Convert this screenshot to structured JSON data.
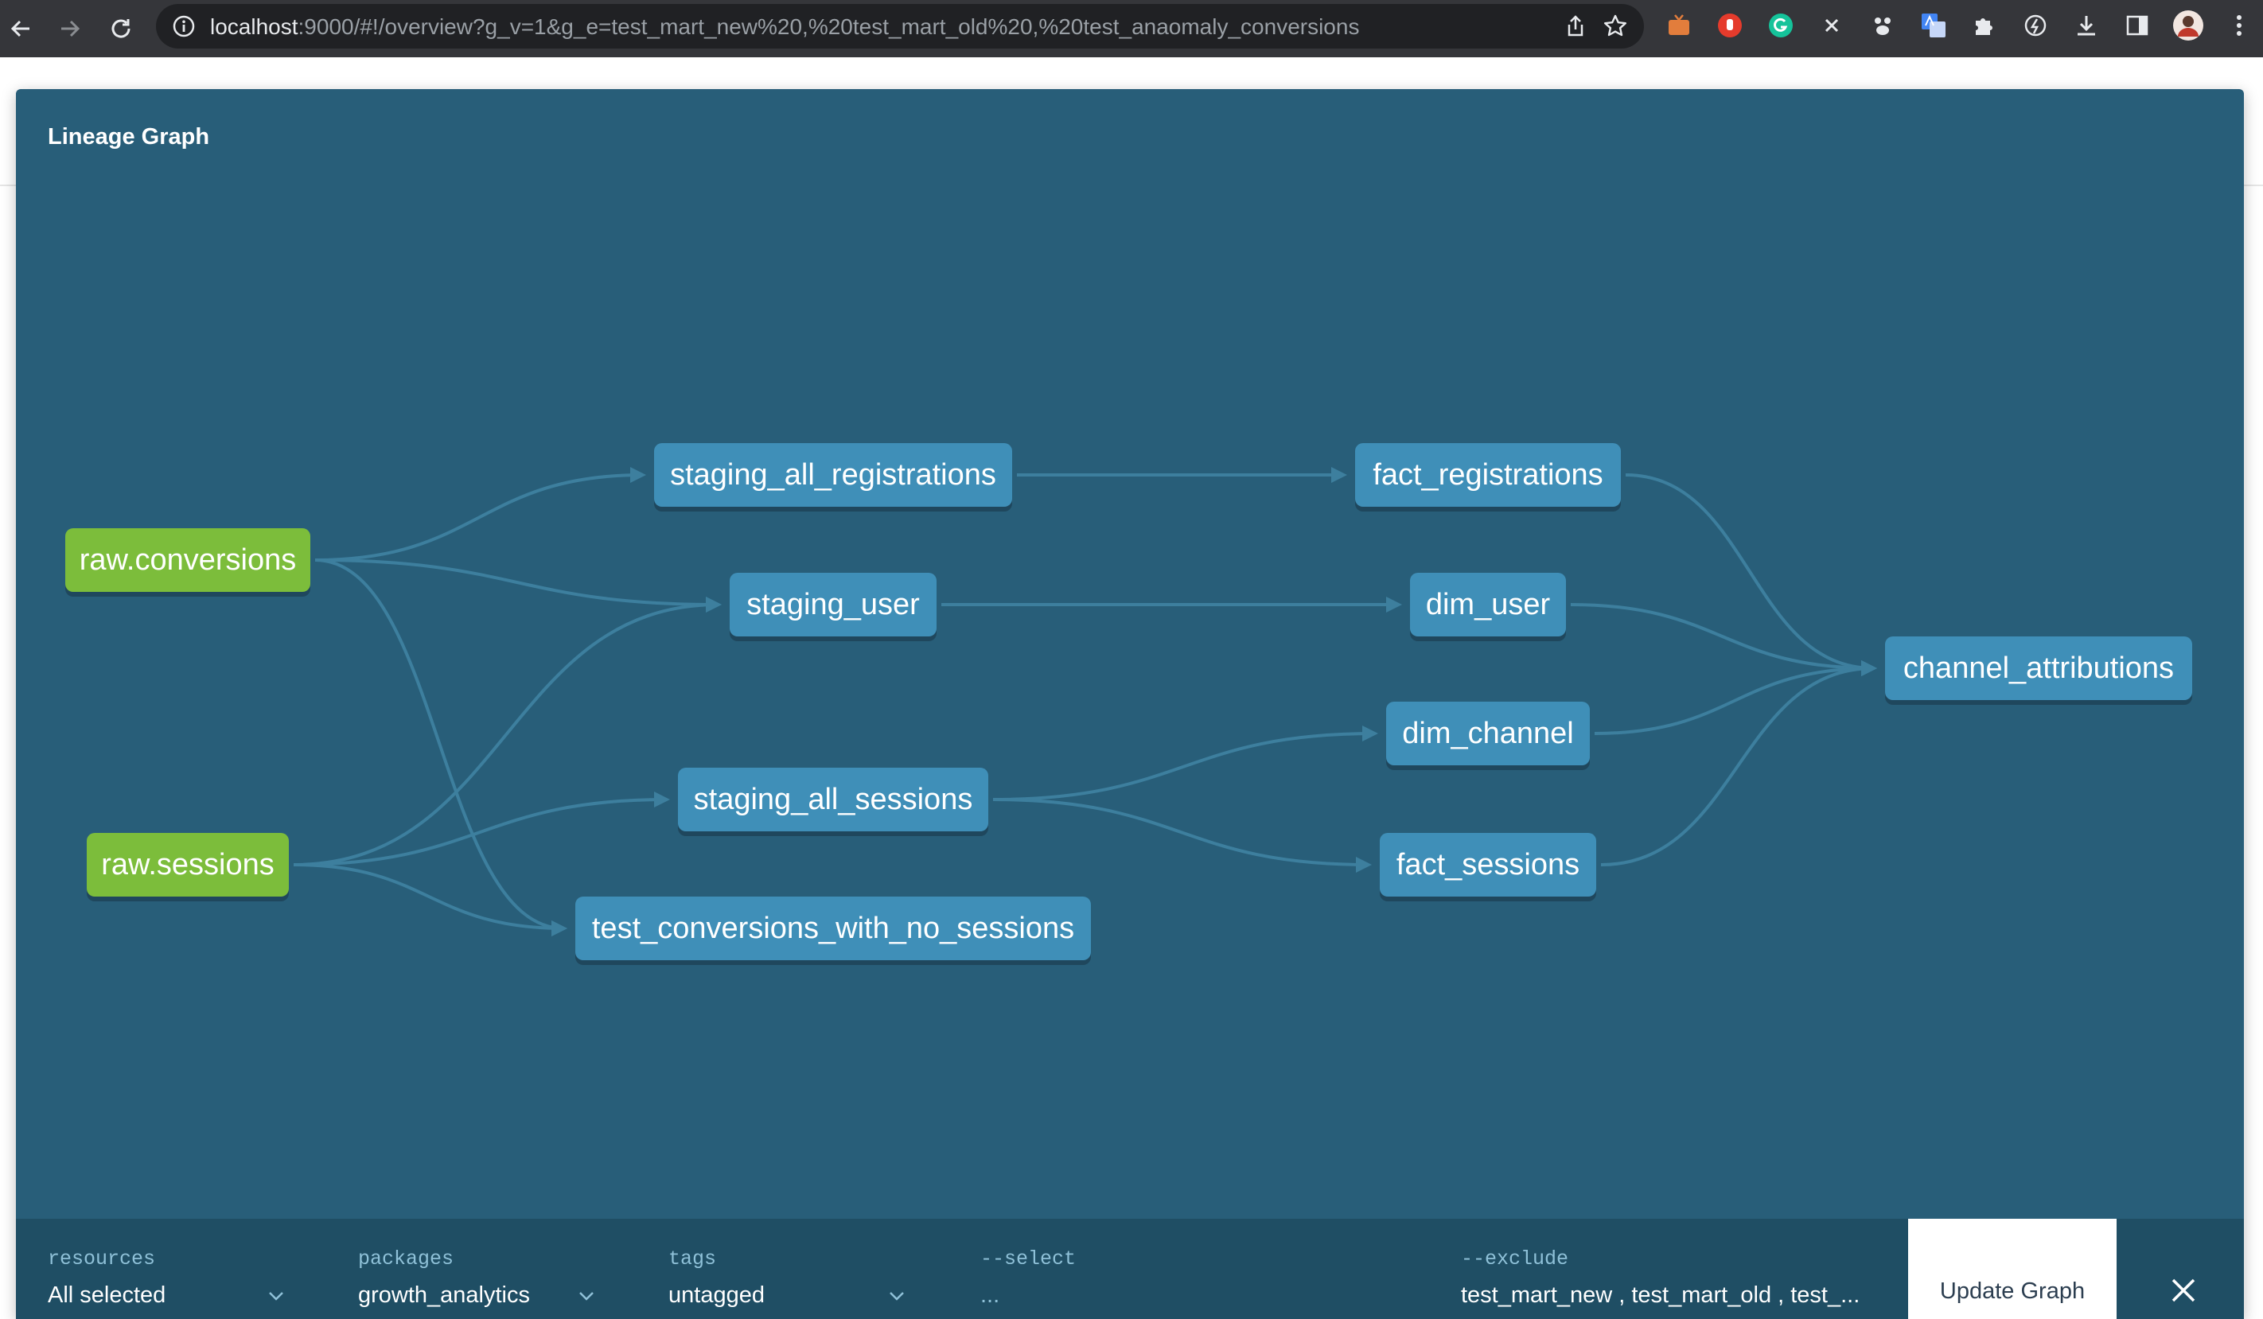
{
  "browser": {
    "url_host": "localhost",
    "url_rest": ":9000/#!/overview?g_v=1&g_e=test_mart_new%20,%20test_mart_old%20,%20test_anaomaly_conversions"
  },
  "modal": {
    "title": "Lineage Graph"
  },
  "graph": {
    "nodes": [
      {
        "id": "raw_conversions",
        "label": "raw.conversions",
        "kind": "source"
      },
      {
        "id": "raw_sessions",
        "label": "raw.sessions",
        "kind": "source"
      },
      {
        "id": "staging_all_registrations",
        "label": "staging_all_registrations",
        "kind": "model"
      },
      {
        "id": "staging_user",
        "label": "staging_user",
        "kind": "model"
      },
      {
        "id": "staging_all_sessions",
        "label": "staging_all_sessions",
        "kind": "model"
      },
      {
        "id": "test_conversions_with_no_sessions",
        "label": "test_conversions_with_no_sessions",
        "kind": "model"
      },
      {
        "id": "fact_registrations",
        "label": "fact_registrations",
        "kind": "model"
      },
      {
        "id": "dim_user",
        "label": "dim_user",
        "kind": "model"
      },
      {
        "id": "dim_channel",
        "label": "dim_channel",
        "kind": "model"
      },
      {
        "id": "fact_sessions",
        "label": "fact_sessions",
        "kind": "model"
      },
      {
        "id": "channel_attributions",
        "label": "channel_attributions",
        "kind": "model"
      }
    ],
    "edges": [
      [
        "raw_conversions",
        "staging_all_registrations"
      ],
      [
        "raw_conversions",
        "staging_user"
      ],
      [
        "raw_conversions",
        "test_conversions_with_no_sessions"
      ],
      [
        "raw_sessions",
        "staging_user"
      ],
      [
        "raw_sessions",
        "staging_all_sessions"
      ],
      [
        "raw_sessions",
        "test_conversions_with_no_sessions"
      ],
      [
        "staging_all_registrations",
        "fact_registrations"
      ],
      [
        "staging_user",
        "dim_user"
      ],
      [
        "staging_all_sessions",
        "dim_channel"
      ],
      [
        "staging_all_sessions",
        "fact_sessions"
      ],
      [
        "fact_registrations",
        "channel_attributions"
      ],
      [
        "dim_user",
        "channel_attributions"
      ],
      [
        "dim_channel",
        "channel_attributions"
      ],
      [
        "fact_sessions",
        "channel_attributions"
      ]
    ],
    "colors": {
      "background": "#285e79",
      "source": "#7cbd3b",
      "model": "#3f8fb8",
      "edge": "#3d7f9e"
    }
  },
  "filters": {
    "resources": {
      "label": "resources",
      "value": "All selected"
    },
    "packages": {
      "label": "packages",
      "value": "growth_analytics"
    },
    "tags": {
      "label": "tags",
      "value": "untagged"
    },
    "select": {
      "label": "--select",
      "value": "..."
    },
    "exclude": {
      "label": "--exclude",
      "value": "test_mart_new , test_mart_old , test_..."
    },
    "update_label": "Update Graph"
  }
}
